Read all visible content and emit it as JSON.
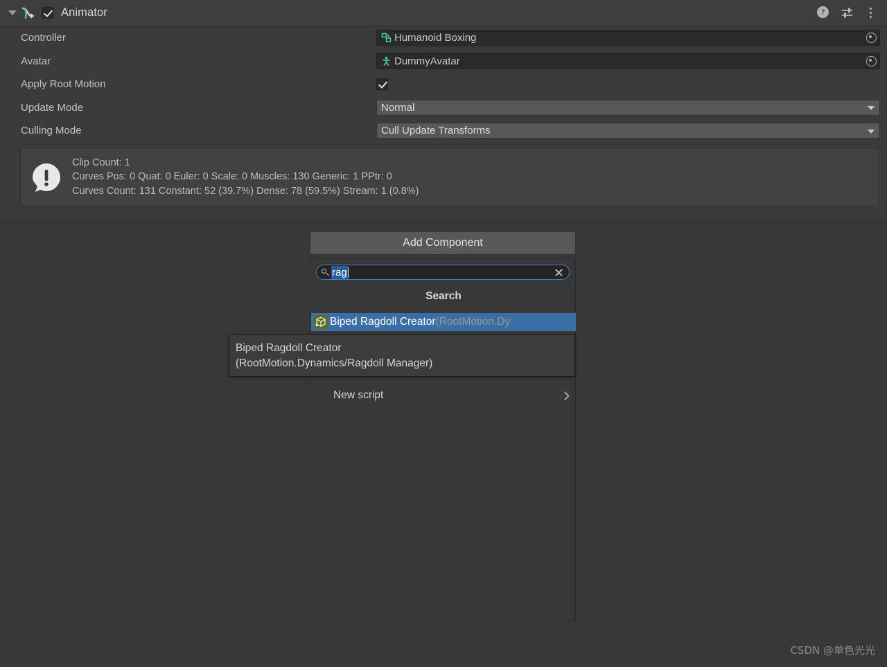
{
  "component": {
    "title": "Animator",
    "enabled": true,
    "foldout_expanded": true,
    "icon": "animator-icon",
    "header_icons": [
      {
        "name": "help-icon",
        "glyph": "?"
      },
      {
        "name": "preset-icon",
        "glyph": "sliders"
      },
      {
        "name": "more-menu-icon",
        "glyph": "kebab"
      }
    ]
  },
  "properties": [
    {
      "label": "Controller",
      "type": "object",
      "value": "Humanoid Boxing",
      "icon": "animator-controller-icon",
      "picker": "object-picker-icon"
    },
    {
      "label": "Avatar",
      "type": "object",
      "value": "DummyAvatar",
      "icon": "avatar-icon",
      "picker": "object-picker-icon"
    },
    {
      "label": "Apply Root Motion",
      "type": "checkbox",
      "checked": true
    },
    {
      "label": "Update Mode",
      "type": "dropdown",
      "value": "Normal"
    },
    {
      "label": "Culling Mode",
      "type": "dropdown",
      "value": "Cull Update Transforms"
    }
  ],
  "info_box": {
    "icon": "warning-icon",
    "line1": "Clip Count: 1",
    "line2": "Curves Pos: 0 Quat: 0 Euler: 0 Scale: 0 Muscles: 130 Generic: 1 PPtr: 0",
    "line3": "Curves Count: 131 Constant: 52 (39.7%) Dense: 78 (59.5%) Stream: 1 (0.8%)"
  },
  "add_component": {
    "button_label": "Add Component",
    "search": {
      "value": "rag",
      "placeholder": "Search",
      "selected": true,
      "clear_icon": "clear-icon",
      "search_icon": "search-icon"
    },
    "header": "Search",
    "results": [
      {
        "name": "Biped Ragdoll Creator",
        "namespace": "(RootMotion.Dy",
        "icon": "script-icon",
        "selected": true
      }
    ],
    "new_script": {
      "label": "New script",
      "chevron": "chevron-right-icon"
    }
  },
  "tooltip": {
    "line1": "Biped Ragdoll Creator",
    "line2": "(RootMotion.Dynamics/Ragdoll Manager)"
  },
  "watermark": "CSDN @单色光光",
  "colors": {
    "window_bg": "#383838",
    "inspector_bg": "#3b3b3b",
    "header_bg": "#3e3e3e",
    "field_bg": "#2a2a2a",
    "dropdown_bg": "#585858",
    "selection_blue": "#3a6ea5",
    "search_highlight": "#2c5d96",
    "search_border": "#3d7fd6",
    "script_icon_bg": "#5d6b23",
    "accent_teal": "#4ad0b0"
  }
}
